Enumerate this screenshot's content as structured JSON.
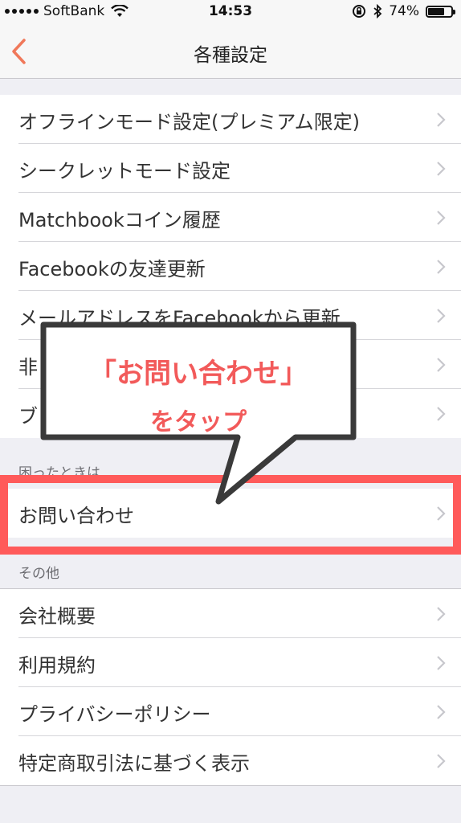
{
  "status_bar": {
    "carrier": "SoftBank",
    "time": "14:53",
    "battery": "74%",
    "battery_level": 0.74
  },
  "nav": {
    "title": "各種設定",
    "back_icon": "chevron-left-icon",
    "accent_color": "#f0785a"
  },
  "groups": {
    "top": {
      "items": [
        {
          "label": "オフラインモード設定(プレミアム限定)"
        },
        {
          "label": "シークレットモード設定"
        },
        {
          "label": "Matchbookコイン履歴"
        },
        {
          "label": "Facebookの友達更新"
        },
        {
          "label": "メールアドレスをFacebookから更新"
        },
        {
          "label": "非"
        },
        {
          "label": "ブ"
        }
      ]
    },
    "trouble": {
      "header": "困ったときは",
      "items": [
        {
          "label": "お問い合わせ"
        }
      ]
    },
    "other": {
      "header": "その他",
      "items": [
        {
          "label": "会社概要"
        },
        {
          "label": "利用規約"
        },
        {
          "label": "プライバシーポリシー"
        },
        {
          "label": "特定商取引法に基づく表示"
        }
      ]
    }
  },
  "callout": {
    "line1": "「お問い合わせ」",
    "line2": "をタップ",
    "text_color": "#f25a5a",
    "highlight_color": "#ff5a5a"
  }
}
